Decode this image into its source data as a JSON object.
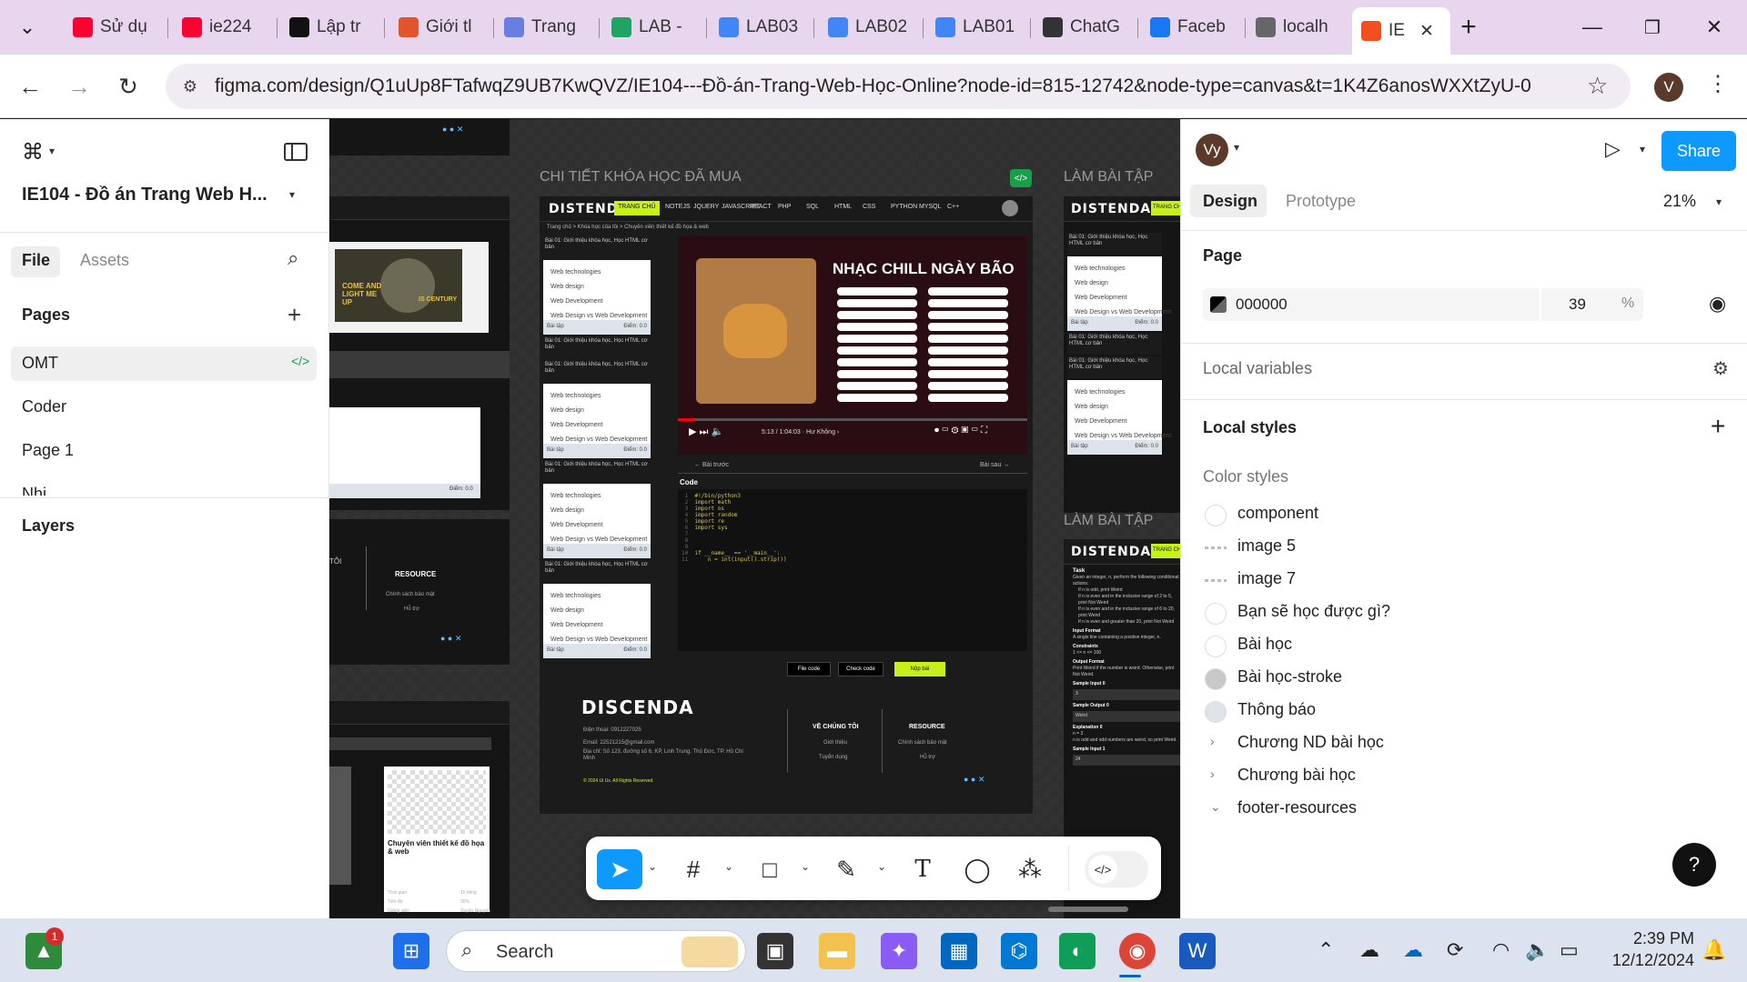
{
  "browser": {
    "tabs": [
      {
        "label": "Sử dụ",
        "icon": "youtube-icon",
        "color": "#ff0033"
      },
      {
        "label": "ie224",
        "icon": "youtube-icon",
        "color": "#ff0033"
      },
      {
        "label": "Lập tr",
        "icon": "page-icon",
        "color": "#111111"
      },
      {
        "label": "Giới tl",
        "icon": "figure-icon",
        "color": "#e0562a"
      },
      {
        "label": "Trang",
        "icon": "wave-icon",
        "color": "#6a7de0"
      },
      {
        "label": "LAB -",
        "icon": "drive-icon",
        "color": "#1fa463"
      },
      {
        "label": "LAB03",
        "icon": "docs-icon",
        "color": "#4285f4"
      },
      {
        "label": "LAB02",
        "icon": "docs-icon",
        "color": "#4285f4"
      },
      {
        "label": "LAB01",
        "icon": "docs-icon",
        "color": "#4285f4"
      },
      {
        "label": "ChatG",
        "icon": "openai-icon",
        "color": "#333333"
      },
      {
        "label": "Faceb",
        "icon": "facebook-icon",
        "color": "#1877f2"
      },
      {
        "label": "localh",
        "icon": "globe-icon",
        "color": "#666666"
      },
      {
        "label": "IE",
        "icon": "figma-icon",
        "color": "#f24e1e"
      }
    ],
    "new_tab": "+",
    "url": "figma.com/design/Q1uUp8FTafwqZ9UB7KwQVZ/IE104---Đồ-án-Trang-Web-Học-Online?node-id=815-12742&node-type=canvas&t=1K4Z6anosWXXtZyU-0",
    "profile_initial": "V"
  },
  "figma": {
    "file_title": "IE104 - Đồ án Trang Web H...",
    "left_tabs": {
      "file": "File",
      "assets": "Assets"
    },
    "pages_title": "Pages",
    "pages": [
      "OMT",
      "Coder",
      "Page 1",
      "Nhi"
    ],
    "layers_title": "Layers",
    "canvas": {
      "frame_labels": [
        "CHI TIẾT KHÓA HỌC ĐÃ MUA",
        "LÀM BÀI TẬP",
        "LÀM BÀI TẬP"
      ],
      "logo": "DISTENDA",
      "nav_items": [
        "TRANG CHỦ",
        "NOTEJS",
        "JQUERY",
        "JAVASCRIPT",
        "REACT",
        "PHP",
        "SQL",
        "HTML",
        "CSS",
        "PYTHON",
        "MYSQL",
        "C++"
      ],
      "left_nav_items": [
        "HTML",
        "CSS",
        "PYTHON",
        "MYSQL",
        "C++"
      ],
      "breadcrumb": "Trang chủ  >  Khóa học của tôi  >  Chuyên viên thiết kế đồ họa & web",
      "lesson_title": "Bài 01: Giới thiệu khóa học, Học HTML cơ bản",
      "lesson_items": [
        "Web technologies",
        "Web design",
        "Web Development",
        "Web Design vs Web Development"
      ],
      "exercise": "Bài tập",
      "score": "Điểm: 0.0",
      "video_title": "NHẠC CHILL NGÀY BÃO",
      "video_time": "5:13 / 1:04:03 · Hư Không ›",
      "prev": "← Bài trước",
      "next": "Bài sau →",
      "code_label": "Code",
      "code_lines": [
        "#!/bin/python3",
        "import math",
        "import os",
        "import random",
        "import re",
        "import sys",
        "",
        "",
        "",
        "if __name__ == '__main__':",
        "    n = int(input().strip())"
      ],
      "buttons": [
        "File code",
        "Check code",
        "Nộp bài"
      ],
      "footer_logo": "DISCENDA",
      "footer_contact": [
        "Điện thoại: 0912227025",
        "Email: 22521215@gmail.com",
        "Địa chỉ: Số 123, đường số 6, KP, Linh Trung, Thủ Đức, TP. Hồ Chí Minh"
      ],
      "footer_copy": "© 2024 Ui Ux. All Rights Reserved.",
      "footer_cols": [
        {
          "title": "VỀ CHÚNG TÔI",
          "items": [
            "Giới thiệu",
            "Tuyển dụng"
          ]
        },
        {
          "title": "RESOURCE",
          "items": [
            "Chính sách bảo mật",
            "Hỗ trợ"
          ]
        }
      ],
      "left_resource": {
        "title": "RESOURCE",
        "items": [
          "Chính sách bảo mật",
          "Hỗ trợ"
        ]
      },
      "hero_text": "COME AND LIGHT ME UP",
      "hero_sub": "IS CENTURY",
      "course_card": "Chuyên viên thiết kế đồ họa & web",
      "course_rows": [
        [
          "Thời gian",
          "15 tiếng"
        ],
        [
          "Tiến độ",
          "30%"
        ],
        [
          "Giảng viên",
          "Xuyến Nguyên"
        ]
      ],
      "task_title": "Task",
      "task_text": "Given an integer, n, perform the following conditional actions:",
      "task_rules": [
        "If n is odd, print Weird",
        "If n is even and in the inclusive range of 2 to 5, print Not Weird",
        "If n is even and in the inclusive range of 6 to 20, print Weird",
        "If n is even and greater than 20, print Not Weird"
      ],
      "task_sections": [
        "Input Format",
        "Constraints",
        "Output Format",
        "Sample Input 0",
        "Sample Output 0",
        "Explanation 0",
        "Sample Input 1"
      ],
      "task_input_format": "A single line containing a positive integer, n.",
      "task_constraints": "1 <= n <= 100",
      "task_output_format": "Print Weird if the number is weird. Otherwise, print Not Weird.",
      "sample_input_0": "3",
      "sample_output_0": "Weird",
      "explanation_0": "n = 3",
      "explanation_0_detail": "n is odd and odd numbers are weird, so print Weird.",
      "sample_input_1": "24"
    },
    "toolbar_tools": [
      "move-tool",
      "frame-tool",
      "shape-tool",
      "pen-tool",
      "text-tool",
      "comment-tool",
      "actions-tool",
      "dev-mode-toggle"
    ],
    "right": {
      "user_initials": "Vy",
      "share": "Share",
      "tabs": {
        "design": "Design",
        "prototype": "Prototype"
      },
      "zoom": "21%",
      "page_title": "Page",
      "page_color": "000000",
      "page_opacity": "39",
      "percent": "%",
      "local_variables": "Local variables",
      "local_styles": "Local styles",
      "color_styles": "Color styles",
      "styles": [
        {
          "name": "component",
          "type": "swatch",
          "color": "#ffffff"
        },
        {
          "name": "image 5",
          "type": "image",
          "color": "#dddddd"
        },
        {
          "name": "image 7",
          "type": "image",
          "color": "#dddddd"
        },
        {
          "name": "Bạn sẽ học được gì?",
          "type": "swatch",
          "color": "#ffffff"
        },
        {
          "name": "Bài học",
          "type": "swatch",
          "color": "#ffffff"
        },
        {
          "name": "Bài học-stroke",
          "type": "swatch",
          "color": "#c8c8c8"
        },
        {
          "name": "Thông báo",
          "type": "swatch",
          "color": "#dfe3ea"
        },
        {
          "name": "Chương ND bài học",
          "type": "group",
          "color": ""
        },
        {
          "name": "Chương bài học",
          "type": "group",
          "color": ""
        },
        {
          "name": "footer-resources",
          "type": "group-open",
          "color": ""
        }
      ],
      "help": "?"
    }
  },
  "taskbar": {
    "search": "Search",
    "time": "2:39 PM",
    "date": "12/12/2024",
    "badge": "1"
  }
}
